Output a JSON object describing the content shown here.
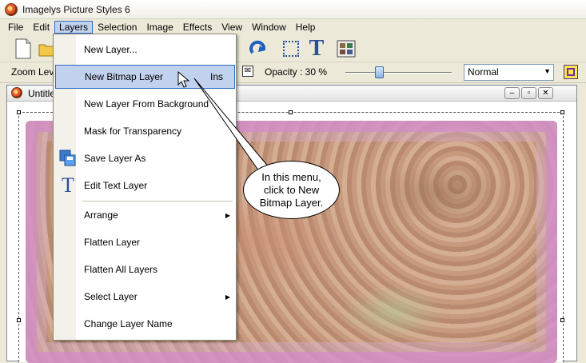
{
  "window": {
    "title": "Imagelys Picture Styles 6"
  },
  "menubar": {
    "items": [
      "File",
      "Edit",
      "Layers",
      "Selection",
      "Image",
      "Effects",
      "View",
      "Window",
      "Help"
    ],
    "active": "Layers"
  },
  "options_bar": {
    "zoom_label": "Zoom Lev",
    "opacity_label": "Opacity : 30 %",
    "opacity_value": 0.3,
    "blend_mode": "Normal"
  },
  "document": {
    "title": "Untitle"
  },
  "layers_menu": {
    "items": [
      {
        "label": "New Layer...",
        "shortcut": ""
      },
      {
        "label": "New Bitmap Layer",
        "shortcut": "Ins"
      },
      {
        "label": "New Layer From Background",
        "shortcut": ""
      },
      {
        "label": "Mask for Transparency",
        "shortcut": ""
      },
      {
        "label": "Save Layer As",
        "shortcut": ""
      },
      {
        "label": "Edit Text Layer",
        "shortcut": ""
      },
      {
        "label": "Arrange",
        "shortcut": ""
      },
      {
        "label": "Flatten Layer",
        "shortcut": ""
      },
      {
        "label": "Flatten All Layers",
        "shortcut": ""
      },
      {
        "label": "Select Layer",
        "shortcut": ""
      },
      {
        "label": "Change Layer Name",
        "shortcut": ""
      }
    ],
    "highlighted": "New Bitmap Layer"
  },
  "callout": {
    "line1": "In this menu,",
    "line2": "click to New",
    "line3": "Bitmap Layer."
  },
  "icons": {
    "text_tool_glyph": "T",
    "edit_text_glyph": "T"
  },
  "colors": {
    "highlight": "#c1d2ee",
    "highlight_border": "#316ac5",
    "text_tool": "#2a4f9e"
  }
}
